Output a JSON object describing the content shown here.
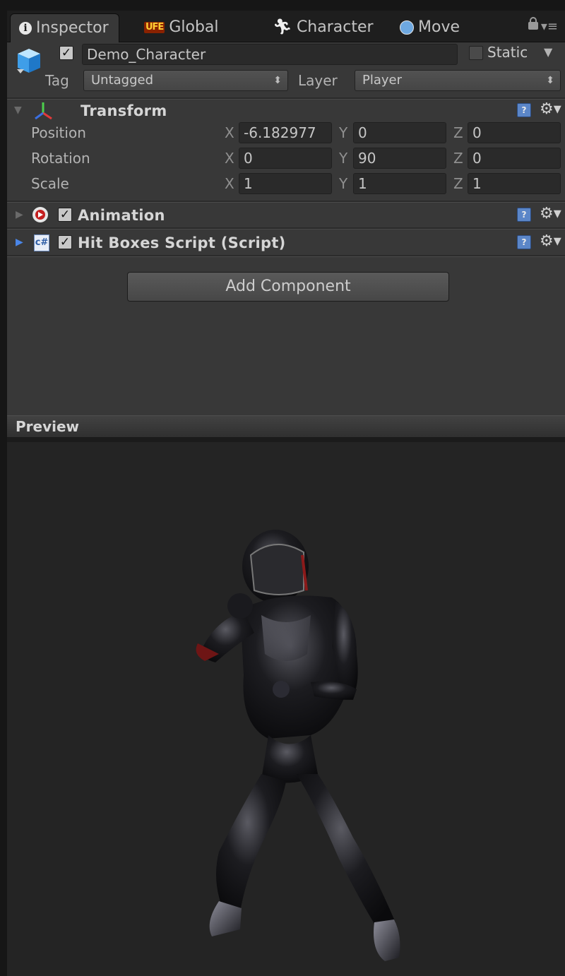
{
  "tabs": [
    {
      "label": "Inspector",
      "icon": "info-icon"
    },
    {
      "label": "Global",
      "icon": "ufe-logo-icon"
    },
    {
      "label": "Character",
      "icon": "running-figure-icon"
    },
    {
      "label": "Move",
      "icon": "move-globe-icon"
    }
  ],
  "gameobject": {
    "active": true,
    "name": "Demo_Character",
    "static_label": "Static",
    "static": false,
    "tag_label": "Tag",
    "tag_value": "Untagged",
    "layer_label": "Layer",
    "layer_value": "Player"
  },
  "transform": {
    "title": "Transform",
    "rows": [
      {
        "label": "Position",
        "x": "-6.182977",
        "y": "0",
        "z": "0"
      },
      {
        "label": "Rotation",
        "x": "0",
        "y": "90",
        "z": "0"
      },
      {
        "label": "Scale",
        "x": "1",
        "y": "1",
        "z": "1"
      }
    ],
    "axis_x": "X",
    "axis_y": "Y",
    "axis_z": "Z"
  },
  "components": [
    {
      "title": "Animation",
      "enabled": true,
      "icon": "animation-play-icon"
    },
    {
      "title": "Hit Boxes Script (Script)",
      "enabled": true,
      "icon": "csharp-script-icon"
    }
  ],
  "add_component_label": "Add Component",
  "preview": {
    "title": "Preview",
    "subject": "character-model-in-fighting-stance"
  },
  "colors": {
    "panel": "#383838",
    "preview_bg": "#242424",
    "accent_blue": "#4a86e8"
  }
}
